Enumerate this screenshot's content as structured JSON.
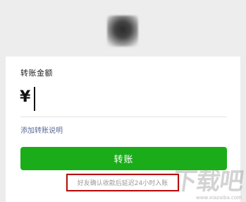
{
  "avatar": {
    "icon": "blurred-profile-avatar"
  },
  "transfer": {
    "amount_label": "转账金额",
    "currency_symbol": "¥",
    "amount_value": "",
    "add_remark_label": "添加转账说明",
    "button_label": "转账",
    "notice": "好友确认收款后延迟24小时入账"
  },
  "watermark": {
    "text": "下载吧",
    "url": "www.xiazaiba.com"
  },
  "colors": {
    "button_green": "#1aad19",
    "link_blue": "#5b6b95",
    "highlight_red": "#b70d0d"
  }
}
